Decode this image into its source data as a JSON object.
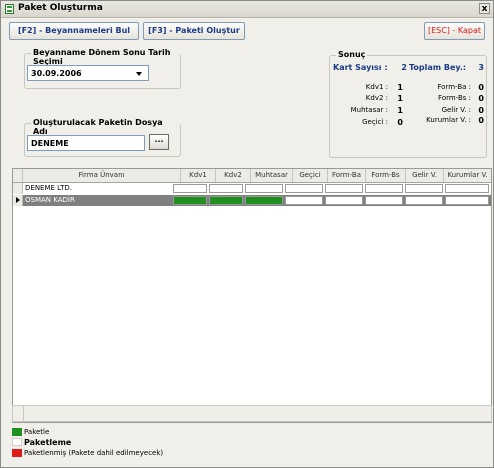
{
  "window": {
    "title": "Paket Oluşturma",
    "close_glyph": "x"
  },
  "toolbar": {
    "find_label": "[F2] - Beyannameleri Bul",
    "create_label": "[F3] - Paketi Oluştur",
    "close_label": "[ESC] - Kapat"
  },
  "period": {
    "legend": "Beyanname Dönem Sonu Tarih Seçimi",
    "value": "30.09.2006"
  },
  "package_file": {
    "legend": "Oluşturulacak Paketin Dosya Adı",
    "value": "DENEME",
    "browse_label": "..."
  },
  "result": {
    "legend": "Sonuç",
    "card_count_label": "Kart Sayısı :",
    "card_count": "2",
    "total_label": "Toplam Bey.:",
    "total": "3",
    "left": [
      {
        "label": "Kdv1 :",
        "value": "1"
      },
      {
        "label": "Kdv2 :",
        "value": "1"
      },
      {
        "label": "Muhtasar :",
        "value": "1"
      },
      {
        "label": "Geçici :",
        "value": "0"
      }
    ],
    "right": [
      {
        "label": "Form-Ba :",
        "value": "0"
      },
      {
        "label": "Form-Bs :",
        "value": "0"
      },
      {
        "label": "Gelir V. :",
        "value": "0"
      },
      {
        "label": "Kurumlar V. :",
        "value": "0"
      }
    ]
  },
  "grid": {
    "columns": [
      "Firma Ünvanı",
      "Kdv1",
      "Kdv2",
      "Muhtasar",
      "Geçici",
      "Form-Ba",
      "Form-Bs",
      "Gelir V.",
      "Kurumlar V."
    ],
    "rows": [
      {
        "firm": "DENEME LTD.",
        "states": [
          "empty",
          "empty",
          "empty",
          "empty",
          "empty",
          "empty",
          "empty",
          "empty"
        ],
        "selected": false
      },
      {
        "firm": "OSMAN KADİR",
        "states": [
          "green",
          "green",
          "green",
          "empty",
          "empty",
          "empty",
          "empty",
          "empty"
        ],
        "selected": true
      }
    ]
  },
  "legend_items": [
    {
      "label": "Paketle",
      "color": "#1f8f1f",
      "bold": false
    },
    {
      "label": "Paketleme",
      "color": "#ffffff",
      "bold": true
    },
    {
      "label": "Paketlenmiş (Pakete dahil edilmeyecek)",
      "color": "#e01b1b",
      "bold": false
    }
  ],
  "colors": {
    "accent": "#1b3c84",
    "green": "#1f8f1f",
    "red": "#e01b1b",
    "selected_row": "#7f7f7f"
  }
}
